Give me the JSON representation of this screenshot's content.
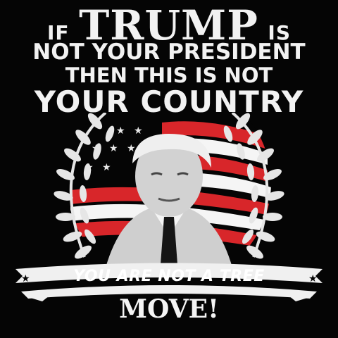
{
  "headline": {
    "line1_prefix": "IF",
    "line1_name": "TRUMP",
    "line1_suffix": "IS",
    "line2": "NOT YOUR PRESIDENT",
    "line3": "THEN THIS IS NOT",
    "line4": "YOUR COUNTRY"
  },
  "banner": {
    "text": "YOU ARE NOT A TREE"
  },
  "footer": {
    "text": "MOVE!"
  },
  "colors": {
    "background": "#050505",
    "text": "#f2f2f2",
    "flag_red": "#d8262a",
    "flag_white": "#f5f5f5",
    "wreath": "#e6e6e6"
  }
}
